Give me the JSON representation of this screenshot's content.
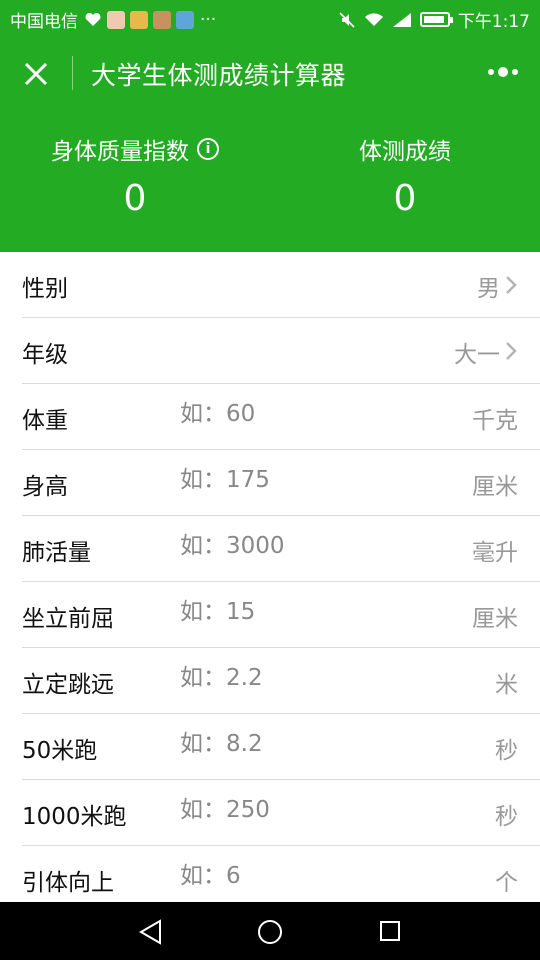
{
  "status_bar": {
    "carrier": "中国电信",
    "more": "···",
    "time": "下午1:17"
  },
  "header": {
    "title": "大学生体测成绩计算器",
    "bmi_label": "身体质量指数",
    "bmi_value": "0",
    "score_label": "体测成绩",
    "score_value": "0"
  },
  "form": {
    "rows": [
      {
        "label": "性别",
        "value": "男",
        "type": "select"
      },
      {
        "label": "年级",
        "value": "大一",
        "type": "select"
      },
      {
        "label": "体重",
        "placeholder": "如：60",
        "unit": "千克",
        "type": "input"
      },
      {
        "label": "身高",
        "placeholder": "如：175",
        "unit": "厘米",
        "type": "input"
      },
      {
        "label": "肺活量",
        "placeholder": "如：3000",
        "unit": "毫升",
        "type": "input"
      },
      {
        "label": "坐立前屈",
        "placeholder": "如：15",
        "unit": "厘米",
        "type": "input"
      },
      {
        "label": "立定跳远",
        "placeholder": "如：2.2",
        "unit": "米",
        "type": "input"
      },
      {
        "label": "50米跑",
        "placeholder": "如：8.2",
        "unit": "秒",
        "type": "input"
      },
      {
        "label": "1000米跑",
        "placeholder": "如：250",
        "unit": "秒",
        "type": "input"
      },
      {
        "label": "引体向上",
        "placeholder": "如：6",
        "unit": "个",
        "type": "input"
      }
    ]
  },
  "colors": {
    "header_green": "#23ab23",
    "text_dark": "#111111",
    "text_gray": "#999999"
  },
  "icons": [
    "close-icon",
    "more-icon",
    "info-icon",
    "chevron-right-icon",
    "back-icon",
    "home-icon",
    "recent-apps-icon"
  ]
}
